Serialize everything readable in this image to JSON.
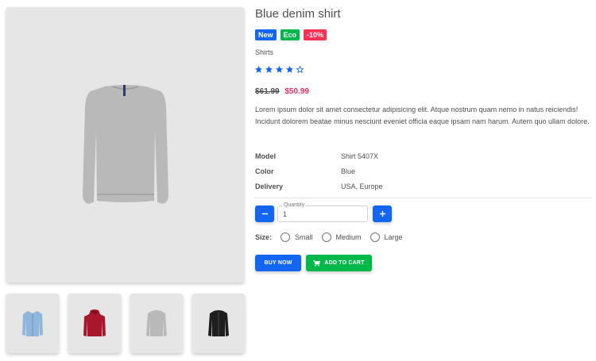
{
  "product": {
    "title": "Blue denim shirt",
    "badges": [
      {
        "label": "New",
        "color": "#1266f1"
      },
      {
        "label": "Eco",
        "color": "#00b74a"
      },
      {
        "label": "-10%",
        "color": "#f93154"
      }
    ],
    "category": "Shirts",
    "rating": 4,
    "rating_max": 5,
    "old_price": "$61.99",
    "new_price": "$50.99",
    "description": "Lorem ipsum dolor sit amet consectetur adipisicing elit. Atque nostrum quam nemo in natus reiciendis! Incidunt dolorem beatae minus nesciunt eveniet officia eaque ipsam nam harum. Autem quo ullam dolore.",
    "specs": [
      {
        "key": "Model",
        "value": "Shirt 5407X"
      },
      {
        "key": "Color",
        "value": "Blue"
      },
      {
        "key": "Delivery",
        "value": "USA, Europe"
      }
    ]
  },
  "gallery": {
    "main_image": "grey-sweatshirt",
    "thumbnails": [
      "blue-shirt",
      "red-hoodie",
      "grey-sweatshirt",
      "black-jacket"
    ]
  },
  "quantity": {
    "label": "Quantity",
    "value": "1",
    "minus_icon": "minus-icon",
    "plus_icon": "plus-icon"
  },
  "size": {
    "label": "Size:",
    "options": [
      "Small",
      "Medium",
      "Large"
    ]
  },
  "actions": {
    "buy_label": "BUY NOW",
    "cart_label": "ADD TO CART",
    "cart_icon": "cart-icon"
  },
  "colors": {
    "primary": "#1266f1",
    "success": "#00b74a",
    "danger": "#f93154",
    "sale_price": "#e0315a"
  }
}
